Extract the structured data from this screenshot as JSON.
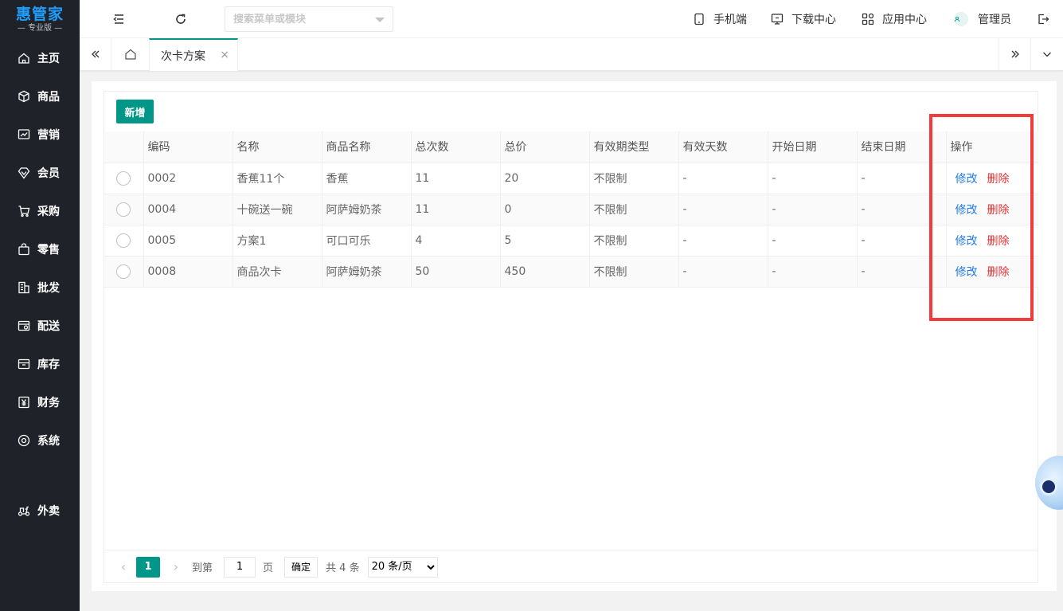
{
  "logo": {
    "main": "惠管家",
    "sub": "— 专业版 —"
  },
  "sidebar": {
    "items": [
      {
        "label": "主页",
        "icon": "home-icon"
      },
      {
        "label": "商品",
        "icon": "box-icon"
      },
      {
        "label": "营销",
        "icon": "chart-icon"
      },
      {
        "label": "会员",
        "icon": "diamond-icon"
      },
      {
        "label": "采购",
        "icon": "cart-icon"
      },
      {
        "label": "零售",
        "icon": "bag-icon"
      },
      {
        "label": "批发",
        "icon": "building-icon"
      },
      {
        "label": "配送",
        "icon": "delivery-icon"
      },
      {
        "label": "库存",
        "icon": "inventory-icon"
      },
      {
        "label": "财务",
        "icon": "yen-icon"
      },
      {
        "label": "系统",
        "icon": "settings-icon"
      },
      {
        "label": "外卖",
        "icon": "scooter-icon"
      }
    ]
  },
  "header": {
    "search_placeholder": "搜索菜单或模块",
    "mobile": "手机端",
    "download": "下载中心",
    "apps": "应用中心",
    "user": "管理员"
  },
  "tabs": {
    "active": "次卡方案",
    "close": "×"
  },
  "toolbar": {
    "add": "新增"
  },
  "table": {
    "headers": [
      "编码",
      "名称",
      "商品名称",
      "总次数",
      "总价",
      "有效期类型",
      "有效天数",
      "开始日期",
      "结束日期",
      "操作"
    ],
    "rows": [
      [
        "0002",
        "香蕉11个",
        "香蕉",
        "11",
        "20",
        "不限制",
        "-",
        "-",
        "-"
      ],
      [
        "0004",
        "十碗送一碗",
        "阿萨姆奶茶",
        "11",
        "0",
        "不限制",
        "-",
        "-",
        "-"
      ],
      [
        "0005",
        "方案1",
        "可口可乐",
        "4",
        "5",
        "不限制",
        "-",
        "-",
        "-"
      ],
      [
        "0008",
        "商品次卡",
        "阿萨姆奶茶",
        "50",
        "450",
        "不限制",
        "-",
        "-",
        "-"
      ]
    ],
    "edit": "修改",
    "delete": "删除"
  },
  "pager": {
    "current": "1",
    "goto": "到第",
    "page_value": "1",
    "page_unit": "页",
    "confirm": "确定",
    "total": "共 4 条",
    "page_size": "20 条/页"
  },
  "colors": {
    "accent": "#009688",
    "sidebar": "#20222a",
    "link": "#1e7ae6",
    "danger": "#e63232",
    "highlight": "#f23b3b"
  }
}
